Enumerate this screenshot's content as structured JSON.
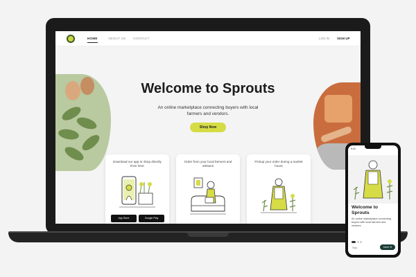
{
  "nav": {
    "home": "HOME",
    "about": "ABOUT US",
    "contact": "CONTACT",
    "login": "LOG IN",
    "signup": "SIGN UP"
  },
  "hero": {
    "title": "Welcome to Sprouts",
    "subtitle": "An online marketplace connecting buyers with local farmers and vendors.",
    "cta": "Shop Now"
  },
  "cards": [
    {
      "text": "Download our app or shop directly from here"
    },
    {
      "text": "Order from your local farmers and artisans"
    },
    {
      "text": "Pickup your order during a market hours"
    }
  ],
  "store_badges": {
    "app_store": "App Store",
    "google_play": "Google Play"
  },
  "phone": {
    "time": "9:41",
    "title": "Welcome to Sprouts",
    "subtitle": "An online marketplace connecting buyers with local farmers and vendors",
    "skip": "Skip",
    "next": "Next ➜"
  },
  "colors": {
    "accent": "#d6dc45",
    "dark_green": "#1c3c38",
    "laptop": "#1b1b1b"
  }
}
